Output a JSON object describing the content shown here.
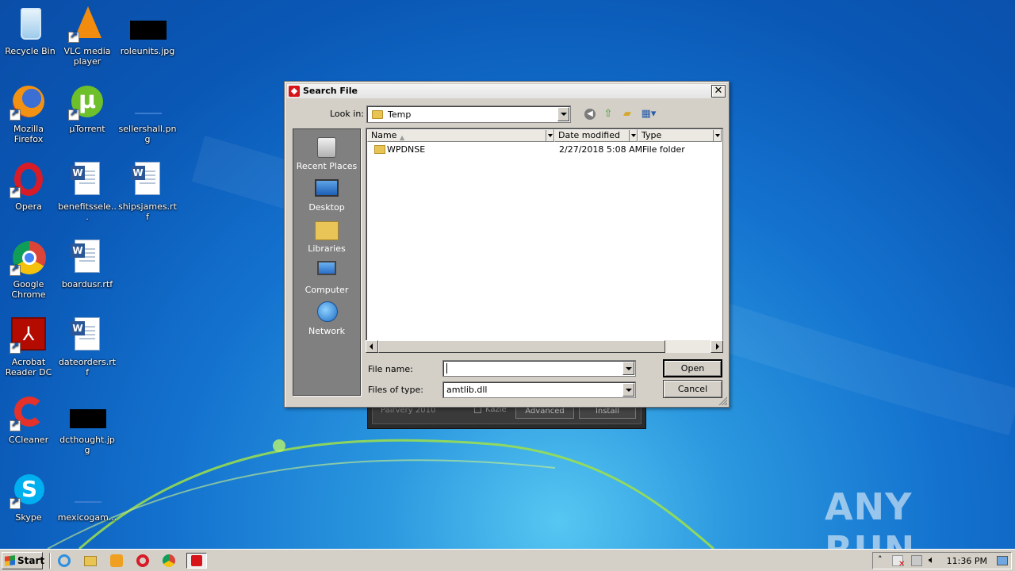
{
  "desktop_icons": [
    {
      "label": "Recycle Bin",
      "icon": "recycle-bin-icon"
    },
    {
      "label": "VLC media player",
      "icon": "vlc-icon"
    },
    {
      "label": "roleunits.jpg",
      "icon": "image-file-icon"
    },
    {
      "label": "Mozilla Firefox",
      "icon": "firefox-icon"
    },
    {
      "label": "µTorrent",
      "icon": "utorrent-icon"
    },
    {
      "label": "sellershall.png",
      "icon": "image-file-icon"
    },
    {
      "label": "Opera",
      "icon": "opera-icon"
    },
    {
      "label": "benefitssele...",
      "icon": "word-doc-icon"
    },
    {
      "label": "shipsjames.rtf",
      "icon": "word-doc-icon"
    },
    {
      "label": "Google Chrome",
      "icon": "chrome-icon"
    },
    {
      "label": "boardusr.rtf",
      "icon": "word-doc-icon"
    },
    {
      "label": "Acrobat Reader DC",
      "icon": "acrobat-icon"
    },
    {
      "label": "dateorders.rtf",
      "icon": "word-doc-icon"
    },
    {
      "label": "CCleaner",
      "icon": "ccleaner-icon"
    },
    {
      "label": "dcthought.jpg",
      "icon": "image-file-icon"
    },
    {
      "label": "Skype",
      "icon": "skype-icon"
    },
    {
      "label": "mexicogam...",
      "icon": "image-file-icon"
    }
  ],
  "background_window": {
    "left_text": "Pairvery 2010",
    "checkbox_label": "Kazie",
    "advanced_label": "Advanced",
    "install_label": "Install"
  },
  "dialog": {
    "title": "Search File",
    "look_in_label": "Look in:",
    "look_in_value": "Temp",
    "places": [
      {
        "label": "Recent Places",
        "icon": "recent-places-icon"
      },
      {
        "label": "Desktop",
        "icon": "desktop-icon"
      },
      {
        "label": "Libraries",
        "icon": "libraries-icon"
      },
      {
        "label": "Computer",
        "icon": "computer-icon"
      },
      {
        "label": "Network",
        "icon": "network-icon"
      }
    ],
    "columns": [
      "Name",
      "Date modified",
      "Type"
    ],
    "files": [
      {
        "name": "WPDNSE",
        "date": "2/27/2018 5:08 AM",
        "type": "File folder"
      }
    ],
    "file_name_label": "File name:",
    "file_name_value": "",
    "files_of_type_label": "Files of type:",
    "files_of_type_value": "amtlib.dll",
    "open_label": "Open",
    "cancel_label": "Cancel"
  },
  "taskbar": {
    "start_label": "Start",
    "clock": "11:36 PM"
  },
  "watermark": "ANY RUN"
}
